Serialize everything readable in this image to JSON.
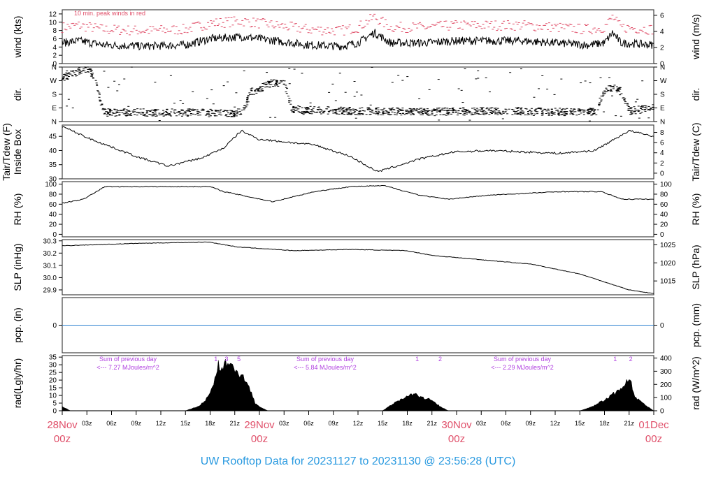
{
  "chart_data": {
    "type": "line",
    "title": "UW Rooftop Data for 20231127  to  20231130 @ 23:56:28  (UTC)",
    "x_range_hours": [
      0,
      72
    ],
    "day_labels": [
      {
        "day": "28Nov",
        "hour": "00z",
        "at": 0
      },
      {
        "day": "29Nov",
        "hour": "00z",
        "at": 24
      },
      {
        "day": "30Nov",
        "hour": "00z",
        "at": 48
      },
      {
        "day": "01Dec",
        "hour": "00z",
        "at": 72
      }
    ],
    "hour_ticks": [
      "03z",
      "06z",
      "09z",
      "12z",
      "15z",
      "18z",
      "21z"
    ],
    "panels": [
      {
        "id": "wind",
        "ylabel": "wind (kts)",
        "ylabel_right": "wind (m/s)",
        "ylim": [
          0,
          13
        ],
        "ticks": [
          0,
          2,
          4,
          6,
          8,
          10,
          12
        ],
        "right_ticks": [
          0,
          2,
          4,
          6
        ],
        "right_factor": 0.5144,
        "annotation": "10 min. peak winds in red",
        "line_color": "#000000",
        "peak_color": "#e0506a",
        "points": [
          [
            0,
            5
          ],
          [
            2,
            5.5
          ],
          [
            5,
            4.5
          ],
          [
            10,
            4.2
          ],
          [
            15,
            4.5
          ],
          [
            18,
            6
          ],
          [
            22,
            6.5
          ],
          [
            26,
            5.5
          ],
          [
            30,
            4.5
          ],
          [
            34,
            4.2
          ],
          [
            36,
            5
          ],
          [
            38,
            7.5
          ],
          [
            40,
            5
          ],
          [
            44,
            5
          ],
          [
            48,
            5.5
          ],
          [
            52,
            5.5
          ],
          [
            56,
            5.5
          ],
          [
            60,
            5
          ],
          [
            64,
            4.5
          ],
          [
            66,
            5
          ],
          [
            67,
            7.5
          ],
          [
            68,
            5
          ],
          [
            72,
            4.5
          ]
        ]
      },
      {
        "id": "dir",
        "ylabel": "dir.",
        "ylabel_right": "dir.",
        "ylim": [
          0,
          360
        ],
        "tick_labels": [
          "N",
          "E",
          "S",
          "W",
          "N"
        ],
        "ticks": [
          0,
          90,
          180,
          270,
          360
        ],
        "points": [
          [
            0,
            290
          ],
          [
            2,
            330
          ],
          [
            3,
            350
          ],
          [
            4,
            300
          ],
          [
            5,
            60
          ],
          [
            10,
            60
          ],
          [
            15,
            60
          ],
          [
            20,
            55
          ],
          [
            22,
            60
          ],
          [
            23,
            200
          ],
          [
            24,
            210
          ],
          [
            25,
            250
          ],
          [
            27,
            260
          ],
          [
            28,
            80
          ],
          [
            35,
            70
          ],
          [
            45,
            65
          ],
          [
            55,
            70
          ],
          [
            63,
            60
          ],
          [
            65,
            65
          ],
          [
            66,
            210
          ],
          [
            67,
            220
          ],
          [
            68,
            210
          ],
          [
            69,
            70
          ],
          [
            72,
            90
          ],
          [
            72,
            150
          ]
        ]
      },
      {
        "id": "temp",
        "ylabel": "Tair/Tdew (F)",
        "ylabel2": "Inside Box",
        "ylabel_right": "Tair/Tdew (C)",
        "ylim": [
          30,
          49
        ],
        "ticks": [
          30,
          35,
          40,
          45
        ],
        "right_ticks": [
          0,
          2,
          4,
          6,
          8
        ],
        "points": [
          [
            0,
            48.5
          ],
          [
            3.5,
            44
          ],
          [
            9.4,
            37.5
          ],
          [
            12.9,
            34.5
          ],
          [
            17.1,
            37.5
          ],
          [
            19.7,
            41
          ],
          [
            21.8,
            47
          ],
          [
            23.9,
            44
          ],
          [
            30.7,
            42
          ],
          [
            35,
            38
          ],
          [
            38.4,
            32.5
          ],
          [
            43.5,
            37
          ],
          [
            47.7,
            39.5
          ],
          [
            52,
            40
          ],
          [
            60.5,
            39
          ],
          [
            64.8,
            40
          ],
          [
            69,
            47
          ],
          [
            72,
            45
          ]
        ]
      },
      {
        "id": "rh",
        "ylabel": "RH (%)",
        "ylabel_right": "RH (%)",
        "ylim": [
          -5,
          105
        ],
        "ticks": [
          0,
          20,
          40,
          60,
          80,
          100
        ],
        "right_ticks": [
          0,
          20,
          40,
          60,
          80,
          100
        ],
        "points": [
          [
            0,
            62
          ],
          [
            2.6,
            70
          ],
          [
            5.2,
            95
          ],
          [
            18,
            95
          ],
          [
            19.7,
            85
          ],
          [
            25.6,
            65
          ],
          [
            30.7,
            85
          ],
          [
            35,
            95
          ],
          [
            39.2,
            97
          ],
          [
            43.5,
            78
          ],
          [
            46.9,
            70
          ],
          [
            52,
            78
          ],
          [
            60.5,
            85
          ],
          [
            65.6,
            85
          ],
          [
            68.2,
            70
          ],
          [
            72,
            70
          ]
        ]
      },
      {
        "id": "slp",
        "ylabel": "SLP (inHg)",
        "ylabel_right": "SLP (hPa)",
        "ylim": [
          29.86,
          30.31
        ],
        "ticks": [
          29.9,
          30.0,
          30.1,
          30.2,
          30.3
        ],
        "right_ticks": [
          1015,
          1020,
          1025
        ],
        "points": [
          [
            0,
            30.26
          ],
          [
            9.4,
            30.28
          ],
          [
            17.9,
            30.29
          ],
          [
            21.3,
            30.25
          ],
          [
            28.2,
            30.22
          ],
          [
            35,
            30.23
          ],
          [
            41.8,
            30.22
          ],
          [
            45.2,
            30.18
          ],
          [
            52,
            30.14
          ],
          [
            57.1,
            30.11
          ],
          [
            63,
            30.03
          ],
          [
            69,
            29.9
          ],
          [
            72,
            29.87
          ]
        ]
      },
      {
        "id": "pcp",
        "ylabel": "pcp. (in)",
        "ylabel_right": "pcp. (mm)",
        "ylim": [
          -1,
          1
        ],
        "ticks": [
          0
        ],
        "right_ticks": [
          0
        ],
        "line_color": "#2a7fd0",
        "points": [
          [
            0,
            0
          ],
          [
            72,
            0
          ]
        ]
      },
      {
        "id": "rad",
        "ylabel": "rad(Lgly/hr)",
        "ylabel_right": "rad (W/m^2)",
        "ylim": [
          0,
          36
        ],
        "ticks": [
          0,
          5,
          10,
          15,
          20,
          25,
          30,
          35
        ],
        "right_ticks": [
          0,
          100,
          200,
          300,
          400
        ],
        "right_factor": 11.63,
        "points": [
          [
            0,
            3
          ],
          [
            1,
            0
          ],
          [
            15,
            0
          ],
          [
            16.5,
            3
          ],
          [
            17.5,
            8
          ],
          [
            18.5,
            20
          ],
          [
            19,
            33
          ],
          [
            19.5,
            30
          ],
          [
            20,
            35
          ],
          [
            21,
            30
          ],
          [
            22,
            24
          ],
          [
            23,
            14
          ],
          [
            23.5,
            5
          ],
          [
            24,
            3
          ],
          [
            25,
            0
          ],
          [
            39,
            0
          ],
          [
            40.5,
            6
          ],
          [
            42,
            11
          ],
          [
            43,
            12
          ],
          [
            44,
            9
          ],
          [
            45,
            8
          ],
          [
            46,
            3
          ],
          [
            47,
            0
          ],
          [
            63,
            0
          ],
          [
            64.5,
            3
          ],
          [
            66,
            8
          ],
          [
            67,
            12
          ],
          [
            68,
            15
          ],
          [
            69,
            25
          ],
          [
            69.7,
            10
          ],
          [
            71,
            4
          ],
          [
            72,
            0
          ]
        ],
        "day_sums": [
          {
            "line1": "Sum of previous day",
            "line2": "<--- 7.27 MJoules/m^2",
            "at": 8
          },
          {
            "line1": "Sum of previous day",
            "line2": "<--- 5.84 MJoules/m^2",
            "at": 32
          },
          {
            "line1": "Sum of previous day",
            "line2": "<--- 2.29 MJoules/m^2",
            "at": 56
          }
        ],
        "hour_marks": [
          {
            "label": "1",
            "at": 18.7
          },
          {
            "label": "3",
            "at": 20
          },
          {
            "label": "5",
            "at": 21.5
          },
          {
            "label": "1",
            "at": 43.2
          },
          {
            "label": "2",
            "at": 46
          },
          {
            "label": "1",
            "at": 67.3
          },
          {
            "label": "2",
            "at": 69.2
          }
        ]
      }
    ]
  }
}
